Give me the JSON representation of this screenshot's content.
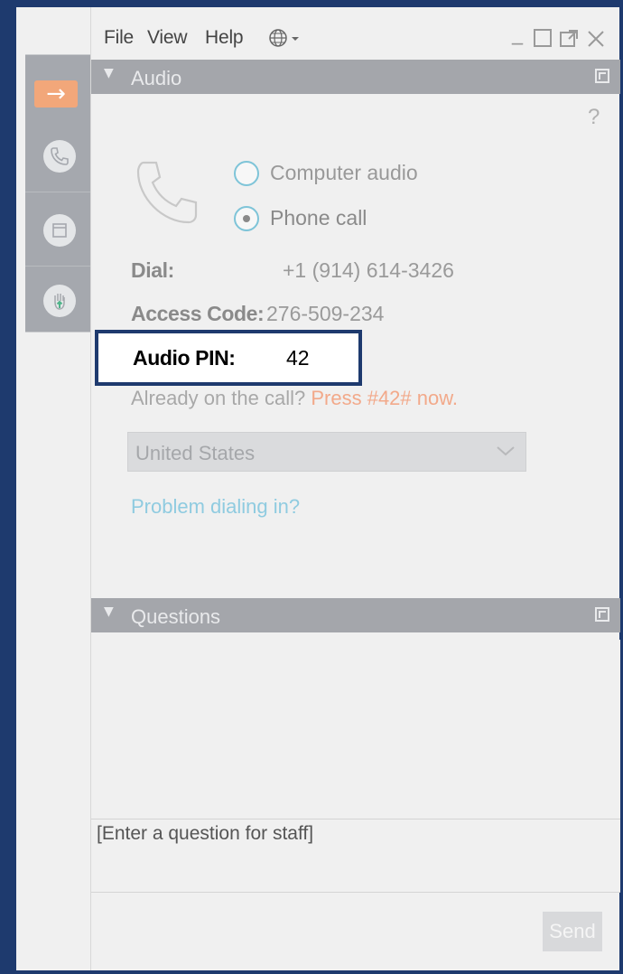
{
  "menubar": {
    "items": [
      "File",
      "View",
      "Help"
    ],
    "language_icon": "globe-icon",
    "window_controls": [
      "minimize-icon",
      "maximize-icon",
      "popout-icon",
      "close-icon"
    ]
  },
  "toolbar": {
    "icons": [
      "collapse-arrow-icon",
      "phone-icon",
      "window-icon",
      "raise-hand-icon"
    ]
  },
  "audio": {
    "header": "Audio",
    "help": "?",
    "options": [
      {
        "label": "Computer audio",
        "selected": false
      },
      {
        "label": "Phone call",
        "selected": true
      }
    ],
    "dial_label": "Dial:",
    "dial_value": "+1 (914) 614-3426",
    "access_label": "Access Code:",
    "access_value": "276-509-234",
    "pin_label": "Audio PIN:",
    "pin_value": "42",
    "already_text": "Already on the call?",
    "press_text": "Press #42# now.",
    "country": "United States",
    "problem_link": "Problem dialing in?"
  },
  "questions": {
    "header": "Questions",
    "placeholder": "[Enter a question for staff]",
    "send_label": "Send"
  },
  "colors": {
    "frame_border": "#1e3a6e",
    "header_bg": "#a4a6ab",
    "accent_orange": "#f2a77a",
    "link_blue": "#8fcbe0"
  }
}
